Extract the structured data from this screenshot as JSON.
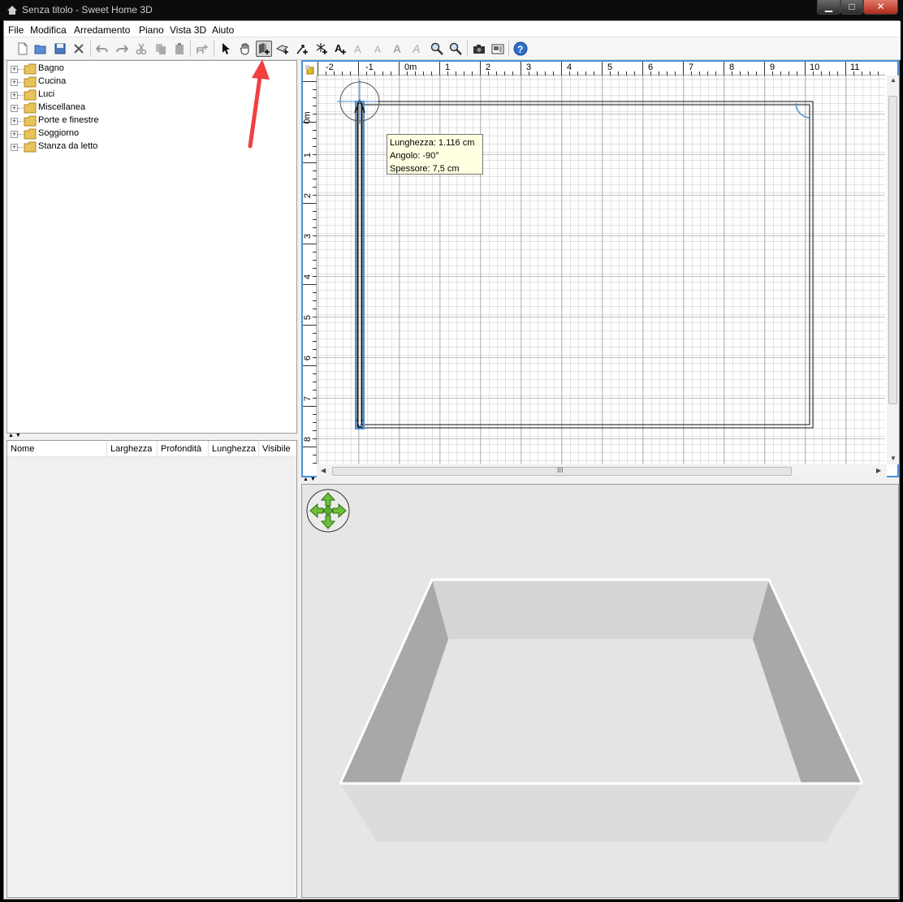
{
  "window": {
    "title": "Senza titolo - Sweet Home 3D",
    "minimize": "▁",
    "maximize": "□",
    "close": "✕"
  },
  "menu": [
    "File",
    "Modifica",
    "Arredamento",
    "Piano",
    "Vista 3D",
    "Aiuto"
  ],
  "toolbar": {
    "icons": [
      "new-home-icon",
      "open-icon",
      "save-icon",
      "preferences-icon",
      "undo-icon",
      "redo-icon",
      "cut-icon",
      "copy-icon",
      "paste-icon",
      "add-furniture-icon",
      "select-mode-icon",
      "pan-mode-icon",
      "create-walls-icon",
      "create-rooms-icon",
      "create-dimensions-icon",
      "create-labels-icon",
      "add-text-icon",
      "increase-text-size-icon",
      "decrease-text-size-icon",
      "bold-text-icon",
      "italic-text-icon",
      "zoom-in-icon",
      "zoom-out-icon",
      "create-photo-icon",
      "create-video-icon",
      "help-icon"
    ],
    "selected": "create-walls-icon"
  },
  "catalog": {
    "categories": [
      "Bagno",
      "Cucina",
      "Luci",
      "Miscellanea",
      "Porte e finestre",
      "Soggiorno",
      "Stanza da letto"
    ]
  },
  "furniture_table": {
    "columns": [
      "Nome",
      "Larghezza",
      "Profondità",
      "Lunghezza",
      "Visibile"
    ]
  },
  "plan": {
    "ruler_x": [
      "-2",
      "-1",
      "0m",
      "1",
      "2",
      "3",
      "4",
      "5",
      "6",
      "7",
      "8",
      "9",
      "10",
      "11"
    ],
    "ruler_y": [
      "0m",
      "1",
      "2",
      "3",
      "4",
      "5",
      "6",
      "7",
      "8"
    ],
    "tooltip": {
      "length": "Lunghezza: 1.116 cm",
      "angle": "Angolo: -90°",
      "thickness": "Spessore: 7,5 cm"
    },
    "scroll_mark": "III"
  },
  "colors": {
    "selection": "#4a90d8",
    "tooltip_bg": "#ffffe1",
    "arrow_annotation": "#f04040",
    "nav_green": "#5cae2e"
  }
}
